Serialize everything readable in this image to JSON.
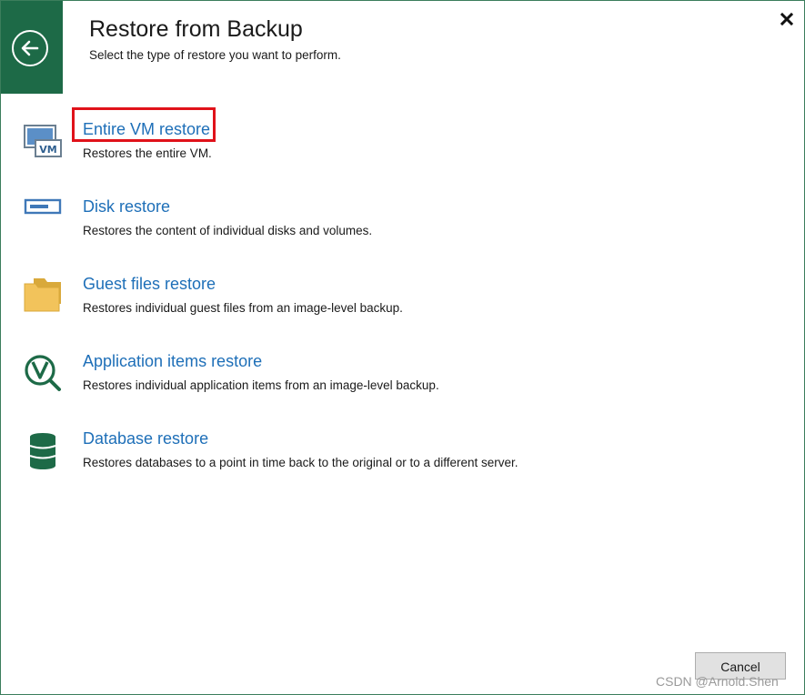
{
  "dialog": {
    "title": "Restore from Backup",
    "subtitle": "Select the type of restore you want to perform."
  },
  "header_icons": {
    "back": "back-arrow-icon",
    "close": "close-icon"
  },
  "options": [
    {
      "icon": "vm-icon",
      "label": "Entire VM restore",
      "description": "Restores the entire VM.",
      "highlighted": true
    },
    {
      "icon": "disk-icon",
      "label": "Disk restore",
      "description": "Restores the content of individual disks and volumes."
    },
    {
      "icon": "folder-icon",
      "label": "Guest files restore",
      "description": "Restores individual guest files from an image-level backup."
    },
    {
      "icon": "application-search-icon",
      "label": "Application items restore",
      "description": "Restores individual application items from an image-level backup."
    },
    {
      "icon": "database-icon",
      "label": "Database restore",
      "description": "Restores databases to a point in time back to the original or to a different server."
    }
  ],
  "footer": {
    "cancel_label": "Cancel",
    "watermark": "CSDN @Arnold.Shen"
  },
  "colors": {
    "brand_green": "#1d6a47",
    "link_blue": "#1e6fb8",
    "highlight_red": "#e0121a"
  }
}
